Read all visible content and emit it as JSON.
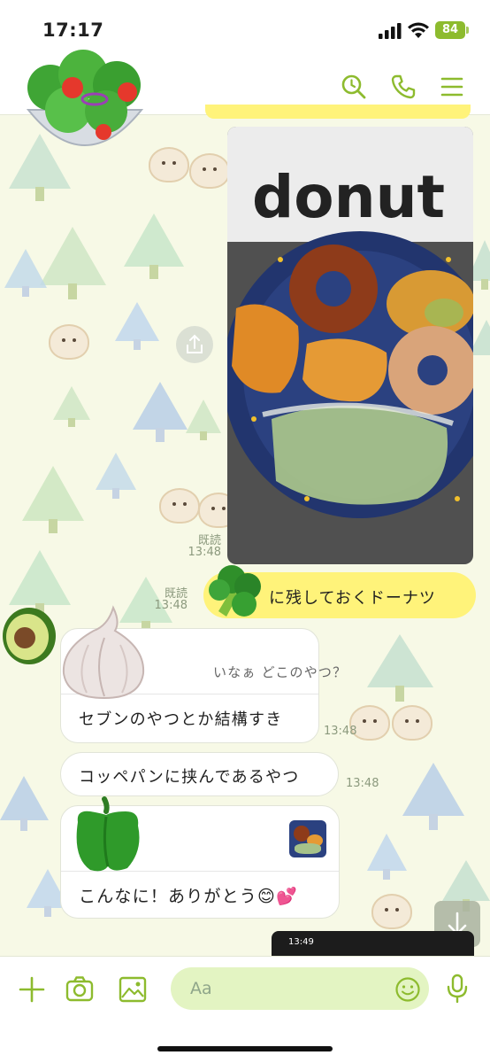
{
  "status_bar": {
    "time": "17:17",
    "battery": "84"
  },
  "header": {
    "search_icon": "search-icon",
    "call_icon": "phone-icon",
    "menu_icon": "menu-icon"
  },
  "colors": {
    "accent": "#8dbb2e",
    "my_bubble": "#fff37a",
    "input_bg": "#e3f4c2"
  },
  "messages": {
    "photo_read": "既読",
    "photo_time": "13:48",
    "my_text_read": "既読",
    "my_text_time": "13:48",
    "my_text": "に残しておくドーナツ",
    "reply_quote": "いなぁ どこのやつ？",
    "reply_text": "セブンのやつとか結構すき",
    "reply_time": "13:48",
    "second_text": "コッペパンに挟んであるやつ",
    "second_time": "13:48",
    "third_text": "こんなに！ありがとう😊💕"
  },
  "photo_labels": {
    "bag_text": "donut"
  },
  "mini_preview": {
    "time": "13:49"
  },
  "input": {
    "placeholder": "Aa"
  }
}
